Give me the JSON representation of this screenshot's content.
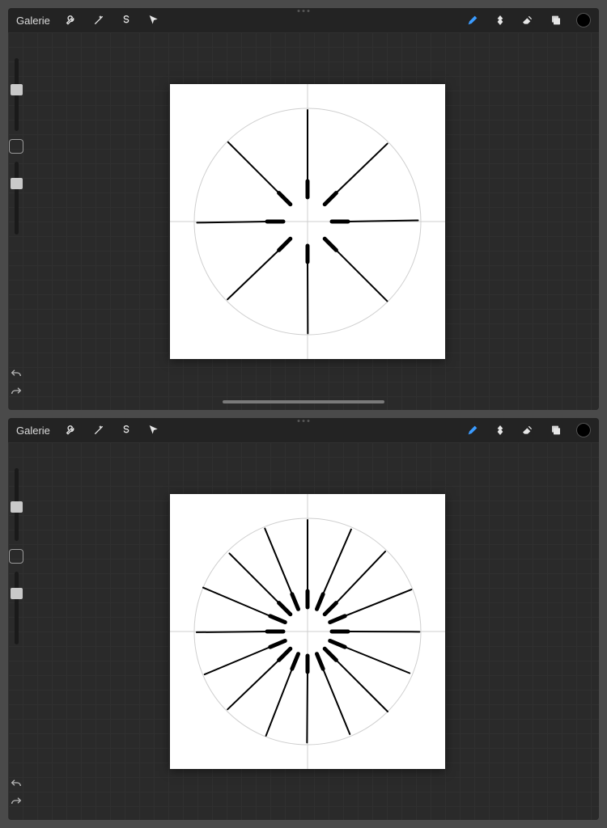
{
  "gallery_label": "Galerie",
  "accent_color": "#3a9bff",
  "toolbar_left_icons": [
    "wrench-icon",
    "wand-icon",
    "s-icon",
    "cursor-icon"
  ],
  "toolbar_right_icons": [
    "brush-icon",
    "smudge-icon",
    "eraser-icon",
    "layers-icon",
    "colorwell"
  ],
  "current_color": "#000000",
  "panels": [
    {
      "id": "panel-a",
      "spokes": 8,
      "slider_top": 0.35,
      "slider_bottom": 0.22
    },
    {
      "id": "panel-b",
      "spokes": 16,
      "slider_top": 0.45,
      "slider_bottom": 0.22
    }
  ],
  "canvas": {
    "size": 340,
    "circle_r": 140,
    "inner_r": 30,
    "outer_r": 138,
    "guide_color": "#cfcfcf",
    "stroke": "#000000",
    "stroke_w": 3
  }
}
